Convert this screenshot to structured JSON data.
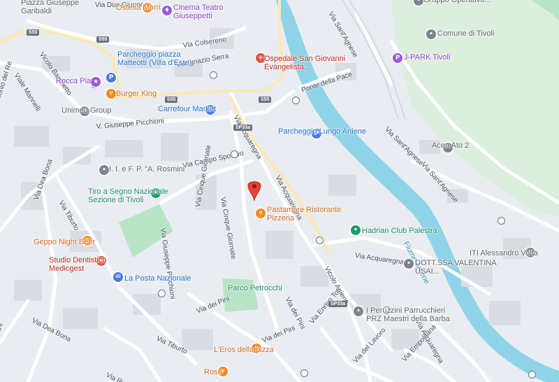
{
  "map": {
    "street_labels": [
      {
        "text": "Via Due Giugno",
        "rot": 0
      },
      {
        "text": "Vicolo Barchetto",
        "rot": 55
      },
      {
        "text": "Via Colsereno",
        "rot": -8
      },
      {
        "text": "Via Ignazio Serra",
        "rot": -10
      },
      {
        "text": "Viale Mannelli",
        "rot": 58
      },
      {
        "text": "Via Antonio del Re",
        "rot": -72
      },
      {
        "text": "V. Giuseppe Picchioni",
        "rot": -5
      },
      {
        "text": "Via Acquaregna",
        "rot": 60
      },
      {
        "text": "Via Acquaregna",
        "rot": 62
      },
      {
        "text": "Via Campo Sportivo",
        "rot": -12
      },
      {
        "text": "Via Cinque Giornate",
        "rot": 80
      },
      {
        "text": "Via Cinque Giornate",
        "rot": -80
      },
      {
        "text": "Via Giuseppe Picchioni",
        "rot": 82
      },
      {
        "text": "Via Tiburto",
        "rot": 60
      },
      {
        "text": "Via Dea Bona",
        "rot": -70
      },
      {
        "text": "Via Dea Bona",
        "rot": 28
      },
      {
        "text": "Via dei Pini",
        "rot": -22
      },
      {
        "text": "Via dei Pini",
        "rot": 62
      },
      {
        "text": "Via dei Pini",
        "rot": -22
      },
      {
        "text": "Via Tiburto",
        "rot": 25
      },
      {
        "text": "Vicolo Aniene",
        "rot": 60
      },
      {
        "text": "Via Acquaregna",
        "rot": 8
      },
      {
        "text": "Via Acquaregna",
        "rot": 60
      },
      {
        "text": "Via Enrico Toti",
        "rot": -50
      },
      {
        "text": "Via del Lavoro",
        "rot": -48
      },
      {
        "text": "Via Empolitana",
        "rot": -48
      },
      {
        "text": "Via Rosario",
        "rot": 28
      },
      {
        "text": "Via Sant'Agnese",
        "rot": 60
      },
      {
        "text": "Via Sant'Agnese",
        "rot": 45
      },
      {
        "text": "Via Sant'Agnese",
        "rot": 48
      },
      {
        "text": "Ponte della Pace",
        "rot": -18
      },
      {
        "text": "Fiume Aniene",
        "rot": 62
      },
      {
        "text": "Ciociani",
        "rot": -70
      }
    ],
    "shields": [
      "S55",
      "S55",
      "S55",
      "S55",
      "SP33a",
      "SP33a"
    ],
    "pois": [
      {
        "name": "Osteria Morri",
        "icon": "restaurant-icon",
        "glyph": "🍴",
        "color": "orange"
      },
      {
        "name": "Cinema Teatro Giuseppetti",
        "icon": "theater-icon",
        "glyph": "♦",
        "color": "purple"
      },
      {
        "name": "Ospedale San Giovanni Evangelista...",
        "icon": "hospital-icon",
        "glyph": "+",
        "color": "red"
      },
      {
        "name": "Parcheggio piazza Matteotti (Villa d'Este)",
        "icon": "parking-icon",
        "glyph": "P",
        "color": "blue"
      },
      {
        "name": "Rocca Pia",
        "icon": "landmark-icon",
        "glyph": "★",
        "color": "purple"
      },
      {
        "name": "Burger King",
        "icon": "restaurant-icon",
        "glyph": "🍴",
        "color": "orange"
      },
      {
        "name": "Unimed Group",
        "icon": "business-icon",
        "glyph": "•",
        "color": "gray"
      },
      {
        "name": "Carrefour Market",
        "icon": "shopping-icon",
        "glyph": "🛒",
        "color": "blue"
      },
      {
        "name": "Parcheggio Lungo Aniene",
        "icon": "parking-icon",
        "glyph": "P",
        "color": "blue"
      },
      {
        "name": "I. I. e F. P. \"A. Rosmini",
        "icon": "school-icon",
        "glyph": "•",
        "color": "gray"
      },
      {
        "name": "Tiro a Segno Nazionale Sezione di Tivoli",
        "icon": "sports-icon",
        "glyph": "•",
        "color": "green"
      },
      {
        "name": "Pastamore Ristorante Pizzeria",
        "icon": "restaurant-icon",
        "glyph": "🍴",
        "color": "orange"
      },
      {
        "name": "Hadrian Club Palestra",
        "icon": "gym-icon",
        "glyph": "•",
        "color": "green"
      },
      {
        "name": "DOTT.SSA VALENTINA USAI...",
        "icon": "business-icon",
        "glyph": "•",
        "color": "gray"
      },
      {
        "name": "ITI Alessandro Volta",
        "icon": "school-icon",
        "glyph": "•",
        "color": "gray"
      },
      {
        "name": "Geppo Night Beer",
        "icon": "bar-icon",
        "glyph": "🍺",
        "color": "orange"
      },
      {
        "name": "Studio Dentistico Medicgest",
        "icon": "medical-icon",
        "glyph": "+",
        "color": "red"
      },
      {
        "name": "La Posta Nazionale",
        "icon": "post-office-icon",
        "glyph": "✉",
        "color": "blue"
      },
      {
        "name": "Parco Petrocchi",
        "icon": "park-icon",
        "glyph": "",
        "color": "green"
      },
      {
        "name": "I Peruzzini Parrucchieri PRZ Maestri della Barba",
        "icon": "business-icon",
        "glyph": "•",
        "color": "gray"
      },
      {
        "name": "L'Eros della pizza",
        "icon": "restaurant-icon",
        "glyph": "🍴",
        "color": "orange"
      },
      {
        "name": "Rose",
        "icon": "restaurant-icon",
        "glyph": "🍴",
        "color": "orange"
      },
      {
        "name": "Piazza Giuseppe Garibaldi",
        "icon": "",
        "glyph": "",
        "color": "gray"
      },
      {
        "name": "Gruppo Operativo...",
        "icon": "business-icon",
        "glyph": "•",
        "color": "gray"
      },
      {
        "name": "Comune di Tivoli",
        "icon": "city-hall-icon",
        "glyph": "•",
        "color": "gray"
      },
      {
        "name": "J-PARK Tivoli",
        "icon": "parking-icon",
        "glyph": "P",
        "color": "purple"
      },
      {
        "name": "Acea Ato 2",
        "icon": "business-icon",
        "glyph": "•",
        "color": "gray"
      }
    ],
    "colors": {
      "water": "#8fd3e8",
      "park": "#b9e3c6",
      "forest": "#d4ecd4",
      "road": "#ffffff",
      "highway": "#fbe9c2",
      "block": "#d9dde3"
    }
  }
}
